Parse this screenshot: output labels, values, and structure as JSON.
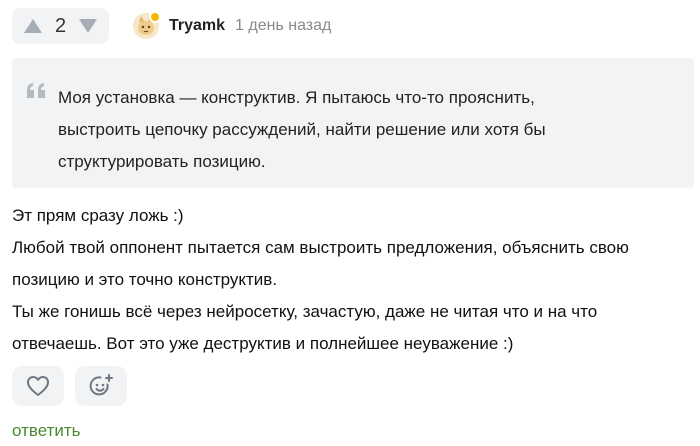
{
  "vote": {
    "count": "2",
    "up_icon": "triangle-up-icon",
    "down_icon": "triangle-down-icon"
  },
  "author": {
    "username": "Tryamk",
    "timestamp": "1 день назад",
    "avatar_icon": "cat-avatar-icon",
    "online_status_color": "#f2b800"
  },
  "quote": {
    "icon": "quote-icon",
    "lines": [
      "Моя установка — конструктив. Я пытаюсь что-то прояснить,",
      "выстроить цепочку рассуждений, найти решение или хотя бы",
      "структурировать позицию."
    ]
  },
  "body": {
    "lines": [
      "Эт прям сразу ложь :)",
      "Любой твой оппонент пытается сам выстроить предложения, объяснить свою",
      "позицию и это точно конструктив.",
      "Ты же гонишь всё через нейросетку, зачастую, даже не читая что и на что",
      "отвечаешь. Вот это уже деструктив и полнейшее неуважение :)"
    ]
  },
  "actions": {
    "like_icon": "heart-icon",
    "reaction_icon": "add-emoji-icon",
    "reply_label": "ответить"
  },
  "colors": {
    "accent_green": "#4a8a34",
    "panel_bg": "#f2f3f5",
    "muted_text": "#8a8a8a"
  }
}
